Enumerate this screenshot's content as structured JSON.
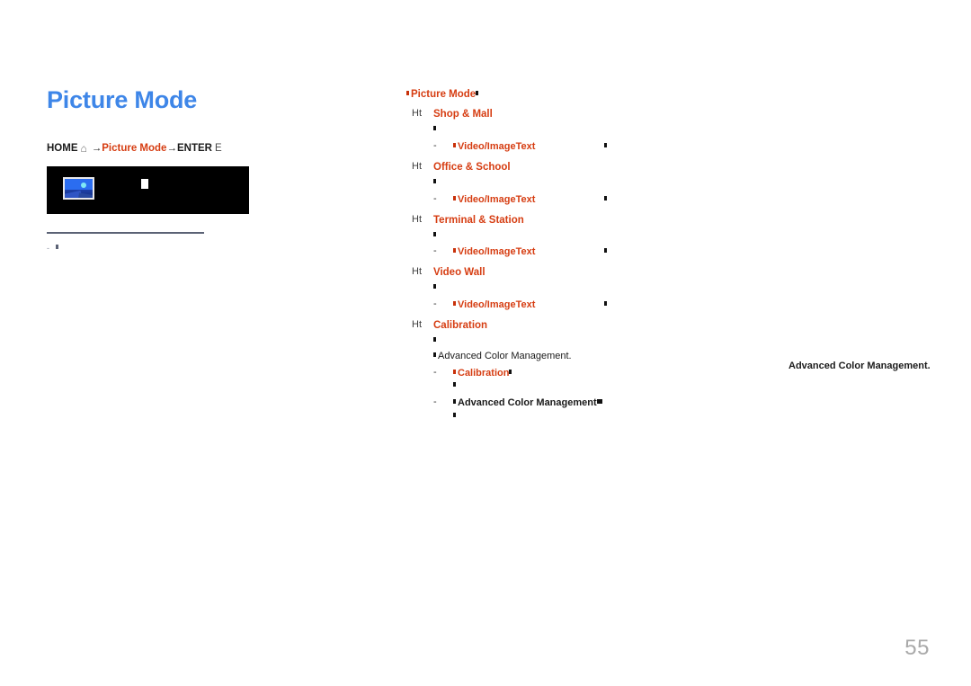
{
  "document": {
    "page_number": "55",
    "title": "Picture Mode"
  },
  "colors": {
    "title_blue": "#3e86e8",
    "accent_red": "#d63d12",
    "body_black": "#1b1b1b",
    "note_slate": "#5b6275",
    "page_number_gray": "#a9a9a9",
    "panel_black": "#000000"
  },
  "breadcrumb": {
    "home_label": "HOME",
    "home_icon": "home-icon",
    "arrow": "→",
    "crumb": "Picture Mode",
    "arrow2": "→",
    "enter_label": "ENTER",
    "enter_glyph": "E"
  },
  "preview_panel": {
    "thumbnail_icon": "picture-thumbnail-icon",
    "secondary_icon": "missing-glyph-icon"
  },
  "left_note": {
    "dash": "-",
    "text": ""
  },
  "right_column": {
    "heading": "Picture Mode",
    "groups": [
      {
        "bullet": "Ht",
        "title": "Shop & Mall",
        "description": "",
        "sub": [
          {
            "dash": "-",
            "label": "Video/Image",
            "label2": "Text",
            "trail": ""
          }
        ]
      },
      {
        "bullet": "Ht",
        "title": "Office & School",
        "description": "",
        "sub": [
          {
            "dash": "-",
            "label": "Video/Image",
            "label2": "Text",
            "trail": ""
          }
        ]
      },
      {
        "bullet": "Ht",
        "title": "Terminal & Station",
        "description": "",
        "sub": [
          {
            "dash": "-",
            "label": "Video/Image",
            "label2": "Text",
            "trail": ""
          }
        ]
      },
      {
        "bullet": "Ht",
        "title": "Video Wall",
        "description": "",
        "sub": [
          {
            "dash": "-",
            "label": "Video/Image",
            "label2": "Text",
            "trail": ""
          }
        ]
      },
      {
        "bullet": "Ht",
        "title": "Calibration",
        "description": "Advanced Color Management.",
        "sub": [
          {
            "dash": "-",
            "label": "Calibration",
            "label2": "",
            "trail": ""
          },
          {
            "dash": "-",
            "label": "Advanced Color Management",
            "label2": "",
            "trail": ""
          }
        ]
      }
    ]
  },
  "side_note": {
    "text": "Advanced Color Management."
  }
}
